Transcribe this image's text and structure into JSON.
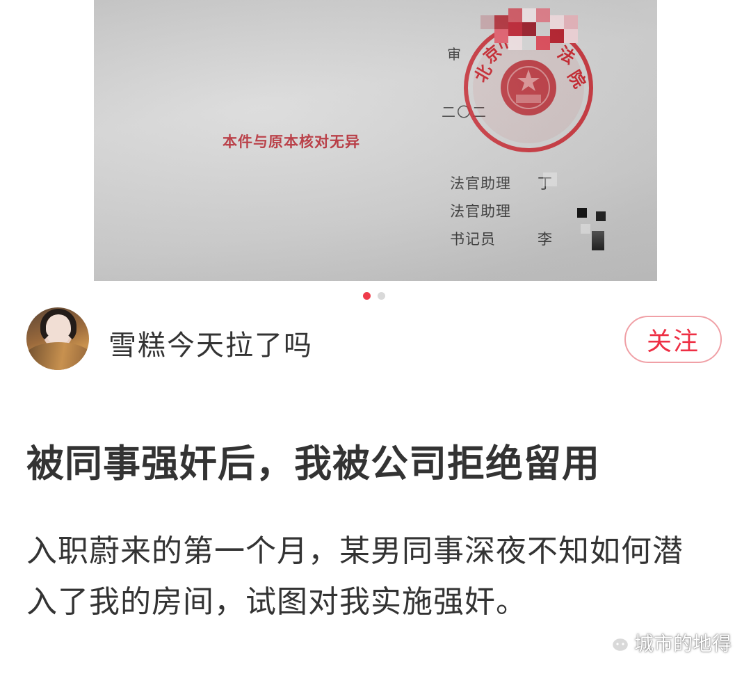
{
  "carousel": {
    "document": {
      "certify_text": "本件与原本核对无异",
      "judge_prefix": "审",
      "date_prefix": "二〇二",
      "staff": [
        {
          "role": "法官助理",
          "name": "丁"
        },
        {
          "role": "法官助理",
          "name": ""
        },
        {
          "role": "书记员",
          "name": "李"
        }
      ],
      "seal_text": "北京市  法院",
      "seal_color": "#c8232c"
    },
    "page_count": 2,
    "active_index": 0
  },
  "author": {
    "name": "雪糕今天拉了吗",
    "follow_label": "关注",
    "avatar_icon": "avatar-photo"
  },
  "post": {
    "title": "被同事强奸后，我被公司拒绝留用",
    "body": "入职蔚来的第一个月，某男同事深夜不知如何潜入了我的房间，试图对我实施强奸。"
  },
  "watermark": {
    "icon": "wechat-icon",
    "label": "城市的地得"
  },
  "colors": {
    "accent": "#ee2f44",
    "text": "#333333",
    "dot_inactive": "#d9d9d9"
  }
}
